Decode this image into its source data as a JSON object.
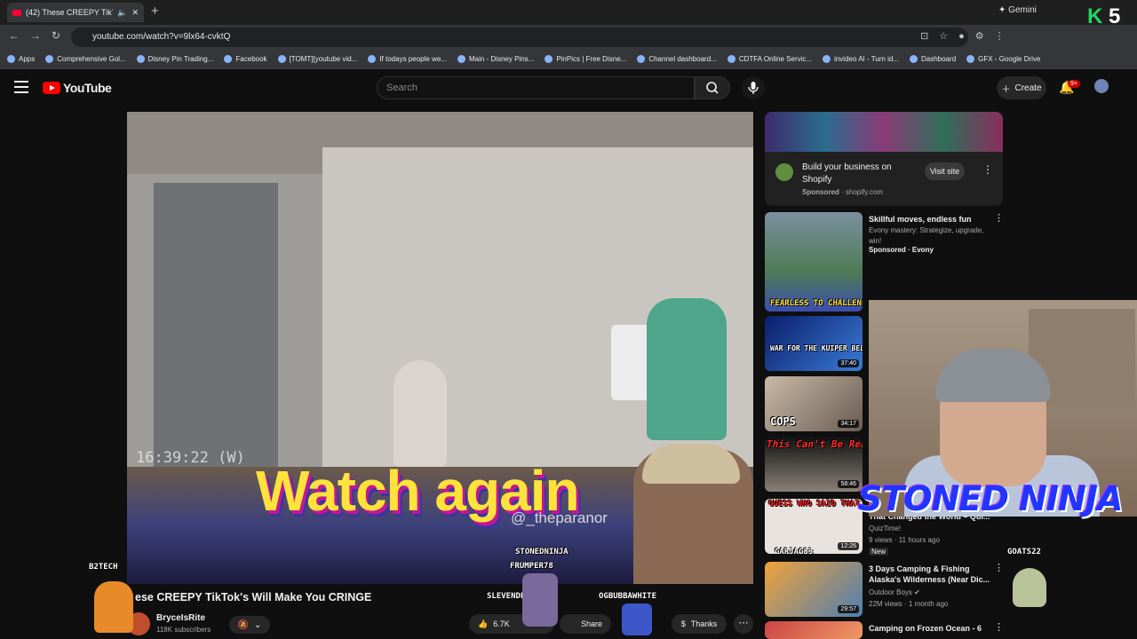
{
  "browser": {
    "tab_title": "(42) These CREEPY TikTok's",
    "url": "youtube.com/watch?v=9lx64-cvktQ",
    "gemini_label": "Gemini",
    "bookmarks": [
      "Apps",
      "Comprehensive Gol...",
      "Disney Pin Trading...",
      "Facebook",
      "[TOMT][youtube vid...",
      "If todays people we...",
      "Main - Disney Pins...",
      "PinPics | Free Disne...",
      "Channel dashboard...",
      "CDTFA Online Servic...",
      "invideo AI - Turn id...",
      "Dashboard",
      "GFX - Google Drive"
    ]
  },
  "youtube": {
    "logo_text": "YouTube",
    "search_placeholder": "Search",
    "create_label": "Create",
    "notification_count": "9+"
  },
  "video": {
    "timestamp": "16:39:22  (W)",
    "overlay_text": "Watch again",
    "watermark": "@_theparanor",
    "title": "ese CREEPY TikTok's Will Make You CRINGE",
    "channel": "BryceIsRite",
    "subscribers": "118K subscribers",
    "likes": "6.7K",
    "share_label": "Share",
    "thanks_label": "Thanks"
  },
  "sidebar": {
    "ad": {
      "title": "Build your business on Shopify",
      "sponsor": "Sponsored",
      "domain": "shopify.com",
      "button": "Visit site"
    },
    "recs": [
      {
        "title": "Skillful moves, endless fun",
        "line2": "Evony mastery: Strategize, upgrade, win!",
        "line3": "Sponsored · Evony",
        "thumb_text": "FEARLESS TO CHALLENGE",
        "duration": ""
      },
      {
        "title": "",
        "line2": "",
        "line3": "",
        "thumb_text": "WAR FOR THE KUIPER BELT",
        "duration": "37:40"
      },
      {
        "title": "",
        "line2": "",
        "line3": "",
        "thumb_text": "COPS",
        "duration": "34:17"
      },
      {
        "title": "",
        "line2": "",
        "line3": "",
        "thumb_text": "This Can't Be Real",
        "duration": "58:46"
      },
      {
        "title": "That Changed the World – Qui...",
        "line2": "QuizTime!",
        "line3": "9 views · 11 hours ago",
        "badge": "New",
        "thumb_text": "GUESS WHO SAID THAT",
        "duration": "12:26"
      },
      {
        "title": "3 Days Camping & Fishing Alaska's Wilderness (Near Dic...",
        "line2": "Outdoor Boys",
        "line3": "22M views · 1 month ago",
        "thumb_text": "",
        "duration": "29:57"
      },
      {
        "title": "Camping on Frozen Ocean - 6",
        "line2": "",
        "line3": "",
        "thumb_text": "",
        "duration": ""
      }
    ]
  },
  "overlay": {
    "streamer_name": "STONED NINJA",
    "viewer_tags": [
      "B2TECH",
      "STONEDNINJA",
      "FRUMPER78",
      "SLEVENDEGREE",
      "OGBUBBAWHITE",
      "CARJAG83",
      "GOATS22"
    ],
    "k_badge": "K",
    "k_number": "5"
  },
  "colors": {
    "youtube_red": "#ff0000",
    "overlay_yellow": "#ffe33b",
    "ninja_blue": "#2036ff"
  }
}
